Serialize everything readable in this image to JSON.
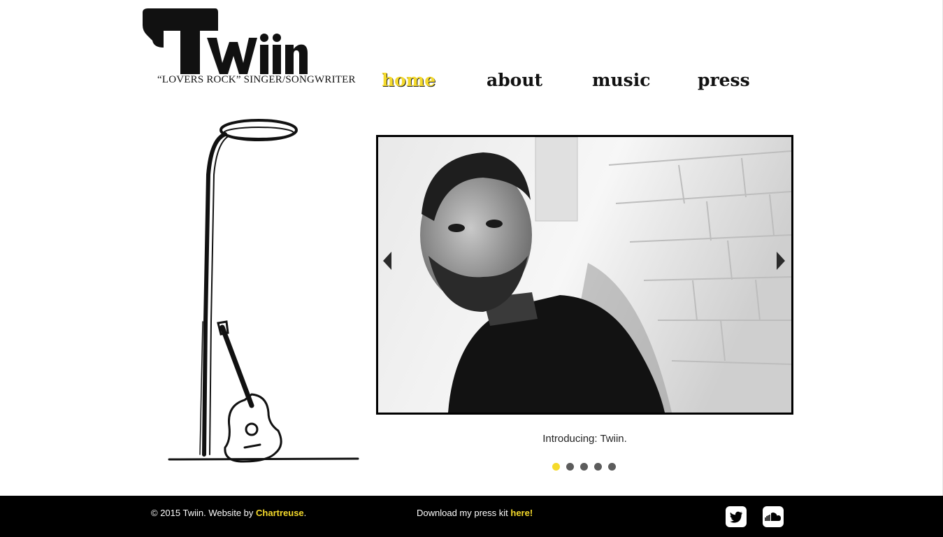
{
  "brand": {
    "wordmark": "Twiin",
    "tagline": "“LOVERS ROCK” SINGER/SONGWRITER"
  },
  "nav": {
    "items": [
      {
        "label": "home",
        "active": true
      },
      {
        "label": "about",
        "active": false
      },
      {
        "label": "music",
        "active": false
      },
      {
        "label": "press",
        "active": false
      }
    ]
  },
  "slider": {
    "caption": "Introducing: Twiin.",
    "slide_count": 5,
    "active_slide": 1
  },
  "footer": {
    "copyright": "© 2015 Twiin. Website by ",
    "credit_link": "Chartreuse",
    "credit_end": ".",
    "presskit_text": "Download my press kit ",
    "presskit_link": "here!"
  },
  "social": [
    "twitter-icon",
    "soundcloud-icon"
  ],
  "colors": {
    "accent": "#f5da2b",
    "footer_bg": "#000000",
    "text": "#111111",
    "dot_inactive": "#5c5c5c"
  }
}
